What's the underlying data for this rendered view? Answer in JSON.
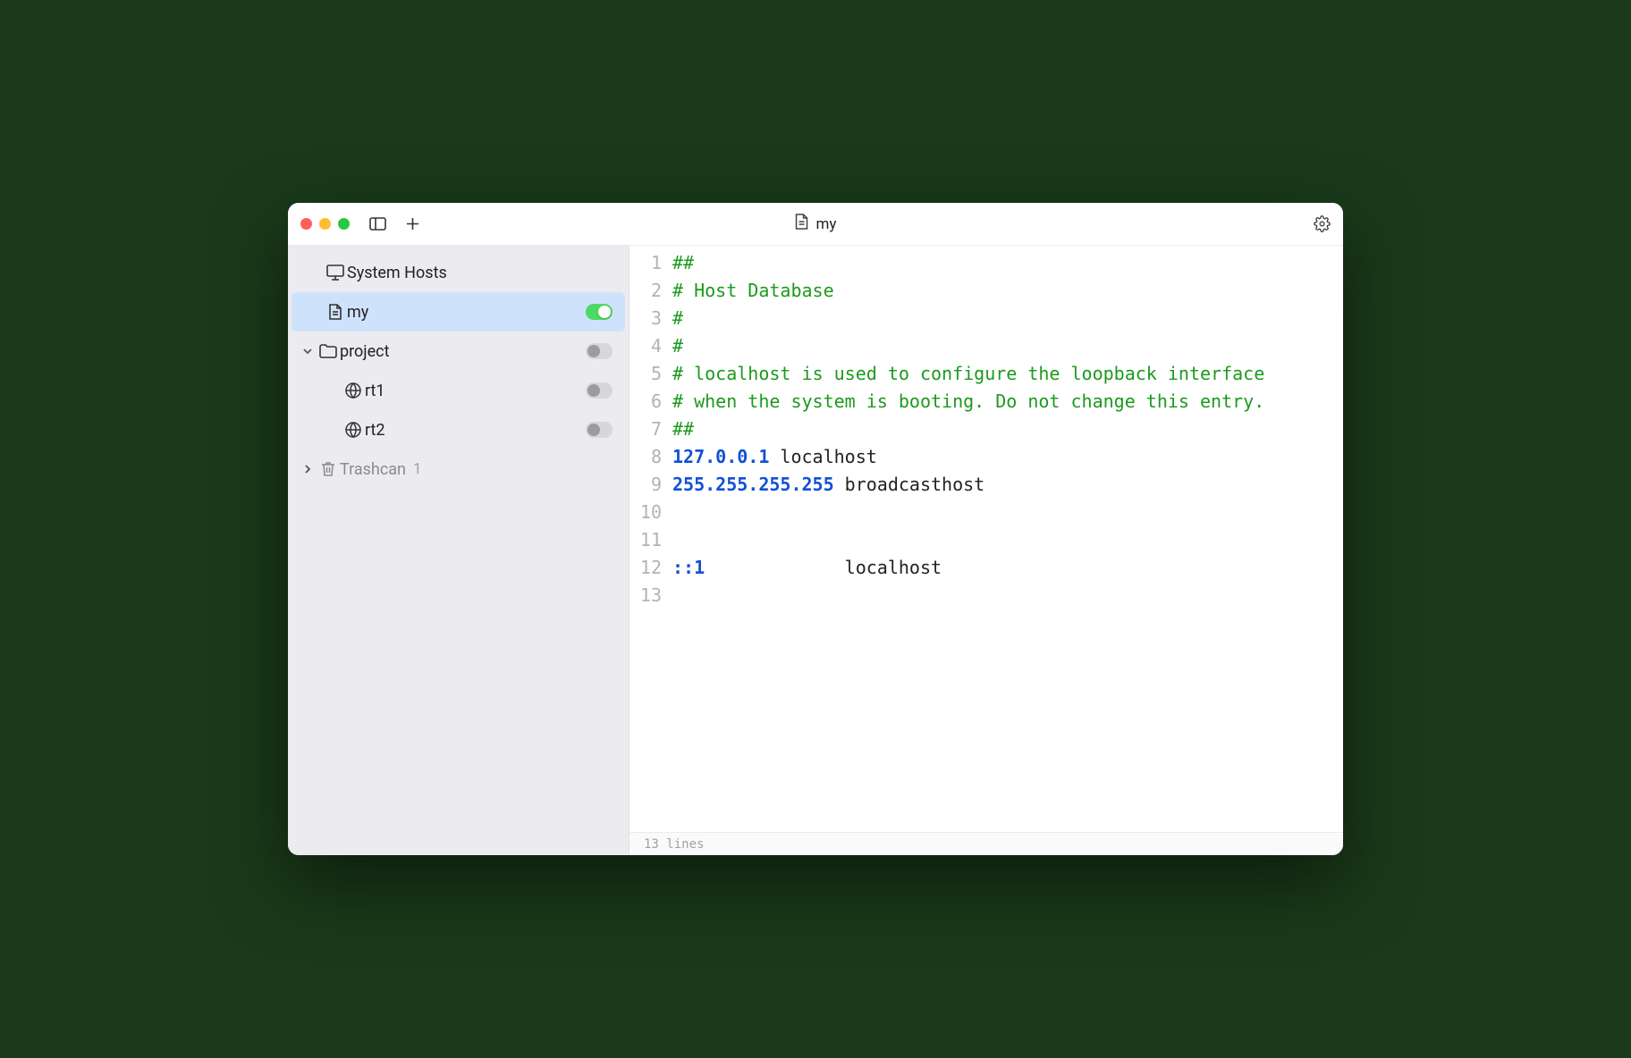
{
  "title": "my",
  "sidebar": {
    "system_hosts": "System Hosts",
    "my_label": "my",
    "project_label": "project",
    "rt1_label": "rt1",
    "rt2_label": "rt2",
    "trashcan_label": "Trashcan",
    "trashcan_count": "1",
    "my_toggle_on": true,
    "project_toggle_on": false,
    "rt1_toggle_on": false,
    "rt2_toggle_on": false
  },
  "editor": {
    "lines": [
      {
        "n": "1",
        "tokens": [
          {
            "t": "comment",
            "v": "##"
          }
        ]
      },
      {
        "n": "2",
        "tokens": [
          {
            "t": "comment",
            "v": "# Host Database"
          }
        ]
      },
      {
        "n": "3",
        "tokens": [
          {
            "t": "comment",
            "v": "#"
          }
        ]
      },
      {
        "n": "4",
        "tokens": [
          {
            "t": "comment",
            "v": "#"
          }
        ]
      },
      {
        "n": "5",
        "tokens": [
          {
            "t": "comment",
            "v": "# localhost is used to configure the loopback interface"
          }
        ]
      },
      {
        "n": "6",
        "tokens": [
          {
            "t": "comment",
            "v": "# when the system is booting. Do not change this entry."
          }
        ]
      },
      {
        "n": "7",
        "tokens": [
          {
            "t": "comment",
            "v": "##"
          }
        ]
      },
      {
        "n": "8",
        "tokens": [
          {
            "t": "ip",
            "v": "127.0.0.1"
          },
          {
            "t": "plain",
            "v": " localhost"
          }
        ]
      },
      {
        "n": "9",
        "tokens": [
          {
            "t": "ip",
            "v": "255.255.255.255"
          },
          {
            "t": "plain",
            "v": " broadcasthost"
          }
        ]
      },
      {
        "n": "10",
        "tokens": []
      },
      {
        "n": "11",
        "tokens": []
      },
      {
        "n": "12",
        "tokens": [
          {
            "t": "ip",
            "v": "::1"
          },
          {
            "t": "plain",
            "v": "             localhost"
          }
        ]
      },
      {
        "n": "13",
        "tokens": []
      }
    ]
  },
  "status": "13 lines"
}
